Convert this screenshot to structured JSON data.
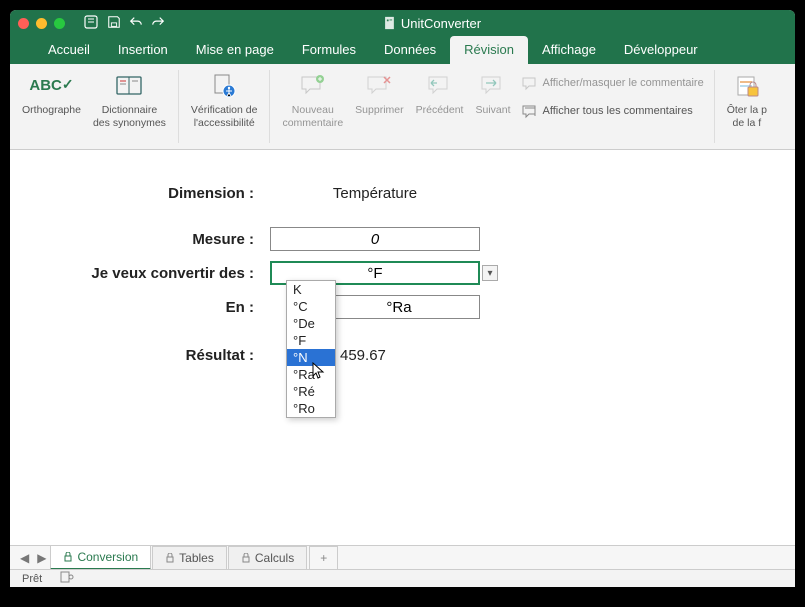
{
  "titlebar": {
    "filename": "UnitConverter"
  },
  "ribbon_tabs": {
    "t0": "Accueil",
    "t1": "Insertion",
    "t2": "Mise en page",
    "t3": "Formules",
    "t4": "Données",
    "t5": "Révision",
    "t6": "Affichage",
    "t7": "Développeur"
  },
  "ribbon": {
    "orthographe": "Orthographe",
    "synonymes": "Dictionnaire\ndes synonymes",
    "accessibilite": "Vérification de\nl'accessibilité",
    "nouveau_commentaire": "Nouveau\ncommentaire",
    "supprimer": "Supprimer",
    "precedent": "Précédent",
    "suivant": "Suivant",
    "toggle_comment": "Afficher/masquer le commentaire",
    "all_comments": "Afficher tous les commentaires",
    "oter": "Ôter la p\nde la f"
  },
  "form": {
    "dimension_label": "Dimension :",
    "dimension_value": "Température",
    "mesure_label": "Mesure :",
    "mesure_value": "0",
    "from_label": "Je veux convertir des :",
    "from_value": "°F",
    "to_label": "En :",
    "to_value": "°Ra",
    "resultat_label": "Résultat :",
    "resultat_value": "459.67"
  },
  "dropdown": {
    "o0": "K",
    "o1": "°C",
    "o2": "°De",
    "o3": "°F",
    "o4": "°N",
    "o5": "°Ra",
    "o6": "°Ré",
    "o7": "°Ro"
  },
  "sheets": {
    "s0": "Conversion",
    "s1": "Tables",
    "s2": "Calculs"
  },
  "status": {
    "ready": "Prêt"
  }
}
